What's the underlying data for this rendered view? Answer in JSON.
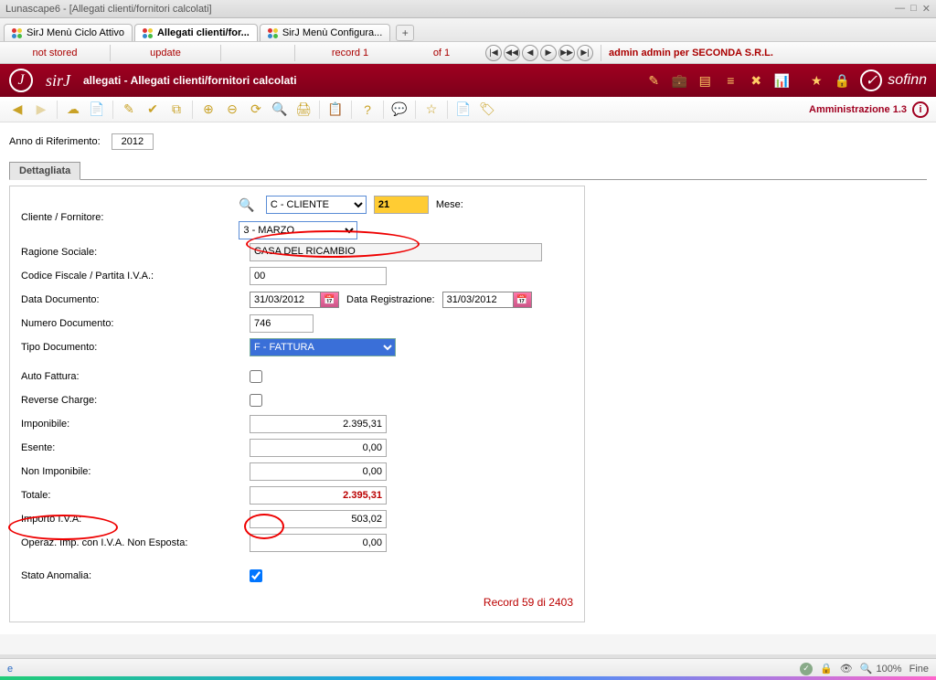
{
  "window": {
    "title": "Lunascape6 - [Allegati clienti/fornitori calcolati]"
  },
  "tabs": [
    {
      "label": "SirJ Menù Ciclo Attivo",
      "active": false
    },
    {
      "label": "Allegati clienti/for...",
      "active": true
    },
    {
      "label": "SirJ Menù Configura...",
      "active": false
    }
  ],
  "statusbar": {
    "not_stored": "not stored",
    "update": "update",
    "record_label": "record 1",
    "of_label": "of 1",
    "admin": "admin admin per SECONDA S.R.L."
  },
  "appheader": {
    "brand": "sirJ",
    "path": "allegati - Allegati clienti/fornitori calcolati",
    "sofinn": "sofinn"
  },
  "toolbar_right": {
    "label": "Amministrazione 1.3"
  },
  "form": {
    "anno_label": "Anno di Riferimento:",
    "anno_value": "2012",
    "tab_label": "Dettagliata",
    "cliente_fornitore_label": "Cliente / Fornitore:",
    "cliente_fornitore_sel": "C - CLIENTE",
    "cliente_code": "21",
    "mese_label": "Mese:",
    "mese_sel": "3 - MARZO",
    "ragione_label": "Ragione Sociale:",
    "ragione_value": "CASA DEL RICAMBIO",
    "cfiva_label": "Codice Fiscale / Partita I.V.A.:",
    "cfiva_value": "00",
    "data_doc_label": "Data Documento:",
    "data_doc_value": "31/03/2012",
    "data_reg_label": "Data Registrazione:",
    "data_reg_value": "31/03/2012",
    "num_doc_label": "Numero Documento:",
    "num_doc_value": "746",
    "tipo_doc_label": "Tipo Documento:",
    "tipo_doc_sel": "F - FATTURA",
    "auto_fattura_label": "Auto Fattura:",
    "reverse_label": "Reverse Charge:",
    "imponibile_label": "Imponibile:",
    "imponibile_value": "2.395,31",
    "esente_label": "Esente:",
    "esente_value": "0,00",
    "non_imp_label": "Non Imponibile:",
    "non_imp_value": "0,00",
    "totale_label": "Totale:",
    "totale_value": "2.395,31",
    "importo_iva_label": "Importo I.V.A:",
    "importo_iva_value": "503,02",
    "oper_iva_label": "Operaz. Imp. con I.V.A. Non Esposta:",
    "oper_iva_value": "0,00",
    "stato_anom_label": "Stato Anomalia:",
    "record_footer": "Record 59 di 2403"
  },
  "osbar": {
    "zoom": "100%",
    "status": "Fine"
  }
}
